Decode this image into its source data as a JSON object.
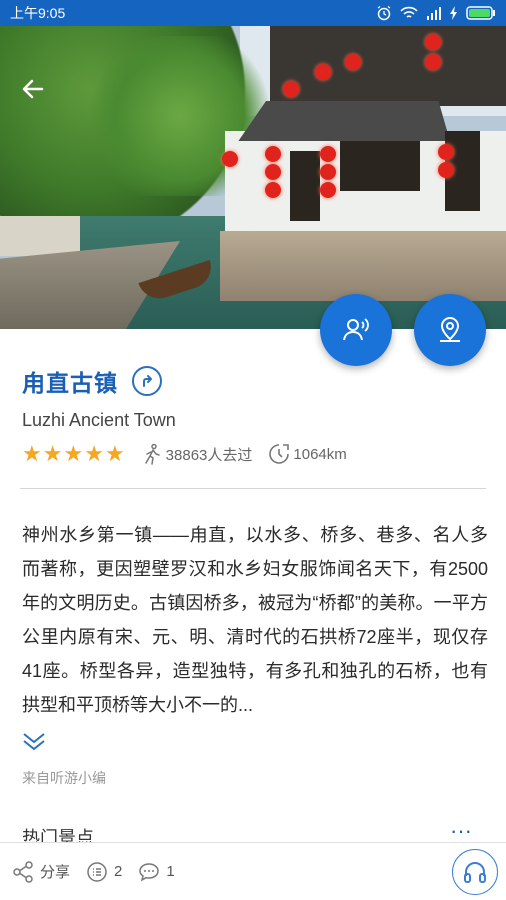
{
  "status_bar": {
    "time": "上午9:05"
  },
  "attraction": {
    "name": "甪直古镇",
    "english_name": "Luzhi  Ancient Town",
    "rating_stars": 5,
    "visitors": "38863人去过",
    "distance": "1064km"
  },
  "description": "神州水乡第一镇——甪直，以水多、桥多、巷多、名人多而著称，更因塑壁罗汉和水乡妇女服饰闻名天下，有2500年的文明历史。古镇因桥多，被冠为“桥都”的美称。一平方公里内原有宋、元、明、清时代的石拱桥72座半，现仅存41座。桥型各异，造型独特，有多孔和独孔的石桥，也有拱型和平顶桥等大小不一的...",
  "source": "来自听游小编",
  "section": {
    "title": "热门景点",
    "more": "···"
  },
  "bottom_bar": {
    "share_label": "分享",
    "list_count": "2",
    "comment_count": "1"
  },
  "colors": {
    "primary": "#1a73d9",
    "title": "#1a5fb4",
    "star": "#f5a623",
    "status_bar": "#1565c0"
  }
}
